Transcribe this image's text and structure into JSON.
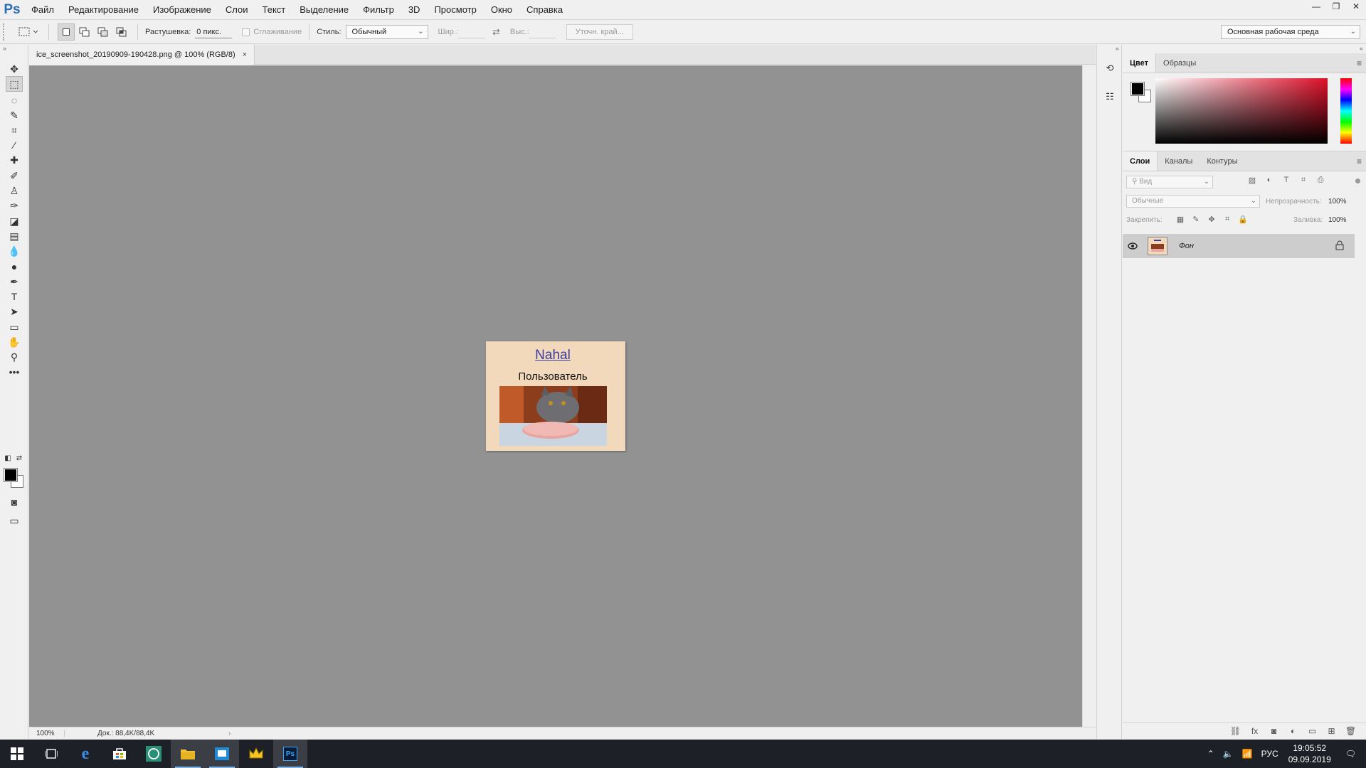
{
  "app": {
    "logo": "Ps",
    "name": "Adobe Photoshop"
  },
  "menu": [
    "Файл",
    "Редактирование",
    "Изображение",
    "Слои",
    "Текст",
    "Выделение",
    "Фильтр",
    "3D",
    "Просмотр",
    "Окно",
    "Справка"
  ],
  "window_controls": {
    "minimize": "—",
    "restore": "❐",
    "close": "✕"
  },
  "options": {
    "feather_label": "Растушевка:",
    "feather_value": "0 пикс.",
    "antialias_label": "Сглаживание",
    "style_label": "Стиль:",
    "style_value": "Обычный",
    "width_label": "Шир.:",
    "height_label": "Выс.:",
    "refine_edge_label": "Уточн. край...",
    "workspace_value": "Основная рабочая среда"
  },
  "tools": [
    {
      "name": "move-tool",
      "icon": "✥"
    },
    {
      "name": "marquee-tool",
      "icon": "⬚",
      "active": true
    },
    {
      "name": "lasso-tool",
      "icon": "◌"
    },
    {
      "name": "quick-select-tool",
      "icon": "✎"
    },
    {
      "name": "crop-tool",
      "icon": "⌗"
    },
    {
      "name": "eyedropper-tool",
      "icon": "⁄"
    },
    {
      "name": "healing-brush-tool",
      "icon": "✚"
    },
    {
      "name": "brush-tool",
      "icon": "✐"
    },
    {
      "name": "clone-stamp-tool",
      "icon": "♙"
    },
    {
      "name": "history-brush-tool",
      "icon": "✑"
    },
    {
      "name": "eraser-tool",
      "icon": "◪"
    },
    {
      "name": "gradient-tool",
      "icon": "▤"
    },
    {
      "name": "blur-tool",
      "icon": "💧"
    },
    {
      "name": "dodge-tool",
      "icon": "●"
    },
    {
      "name": "pen-tool",
      "icon": "✒"
    },
    {
      "name": "type-tool",
      "icon": "T"
    },
    {
      "name": "path-selection-tool",
      "icon": "➤"
    },
    {
      "name": "rectangle-tool",
      "icon": "▭"
    },
    {
      "name": "hand-tool",
      "icon": "✋"
    },
    {
      "name": "zoom-tool",
      "icon": "⚲"
    },
    {
      "name": "more-tools",
      "icon": "•••"
    }
  ],
  "document": {
    "tab_title": "ice_screenshot_20190909-190428.png @ 100% (RGB/8)",
    "tab_close": "×",
    "status_zoom": "100%",
    "status_doc": "Док.: 88,4K/88,4K"
  },
  "image": {
    "link_text": "Nahal",
    "role_text": "Пользователь"
  },
  "color_panel": {
    "tabs": [
      "Цвет",
      "Образцы"
    ],
    "foreground": "#000000",
    "background": "#ffffff"
  },
  "layers_panel": {
    "tabs": [
      "Слои",
      "Каналы",
      "Контуры"
    ],
    "kind_placeholder": "Вид",
    "blend_mode": "Обычные",
    "opacity_label": "Непрозрачность:",
    "opacity_value": "100%",
    "lock_label": "Закрепить:",
    "fill_label": "Заливка:",
    "fill_value": "100%",
    "layers": [
      {
        "name": "Фон",
        "visible": true,
        "locked": true
      }
    ]
  },
  "taskbar": {
    "lang": "РУС",
    "time": "19:05:52",
    "date": "09.09.2019"
  }
}
